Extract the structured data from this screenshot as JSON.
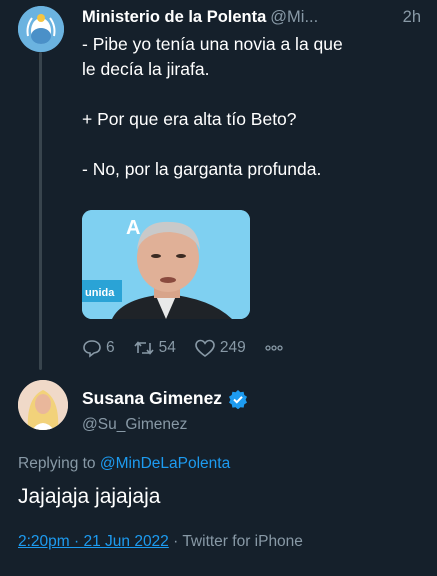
{
  "tweet1": {
    "author_name": "Ministerio de la Polenta",
    "author_handle": "@Mi...",
    "time": "2h",
    "lines": [
      "- Pibe yo tenía una novia a la que\nle decía la jirafa.",
      "+ Por que era alta tío Beto?",
      "- No, por la garganta profunda."
    ],
    "media": {
      "caption_partial": "A",
      "banner_text": "unida"
    },
    "replies": "6",
    "retweets": "54",
    "likes": "249"
  },
  "tweet2": {
    "author_name": "Susana Gimenez",
    "author_handle": "@Su_Gimenez",
    "replying_prefix": "Replying to",
    "replying_to": "@MinDeLaPolenta",
    "text": "Jajajaja jajajaja",
    "timestamp": "2:20pm · 21 Jun 2022",
    "source": "· Twitter for iPhone"
  },
  "colors": {
    "background": "#15202b",
    "secondary_text": "#8899a6",
    "link": "#1d9bf0"
  }
}
